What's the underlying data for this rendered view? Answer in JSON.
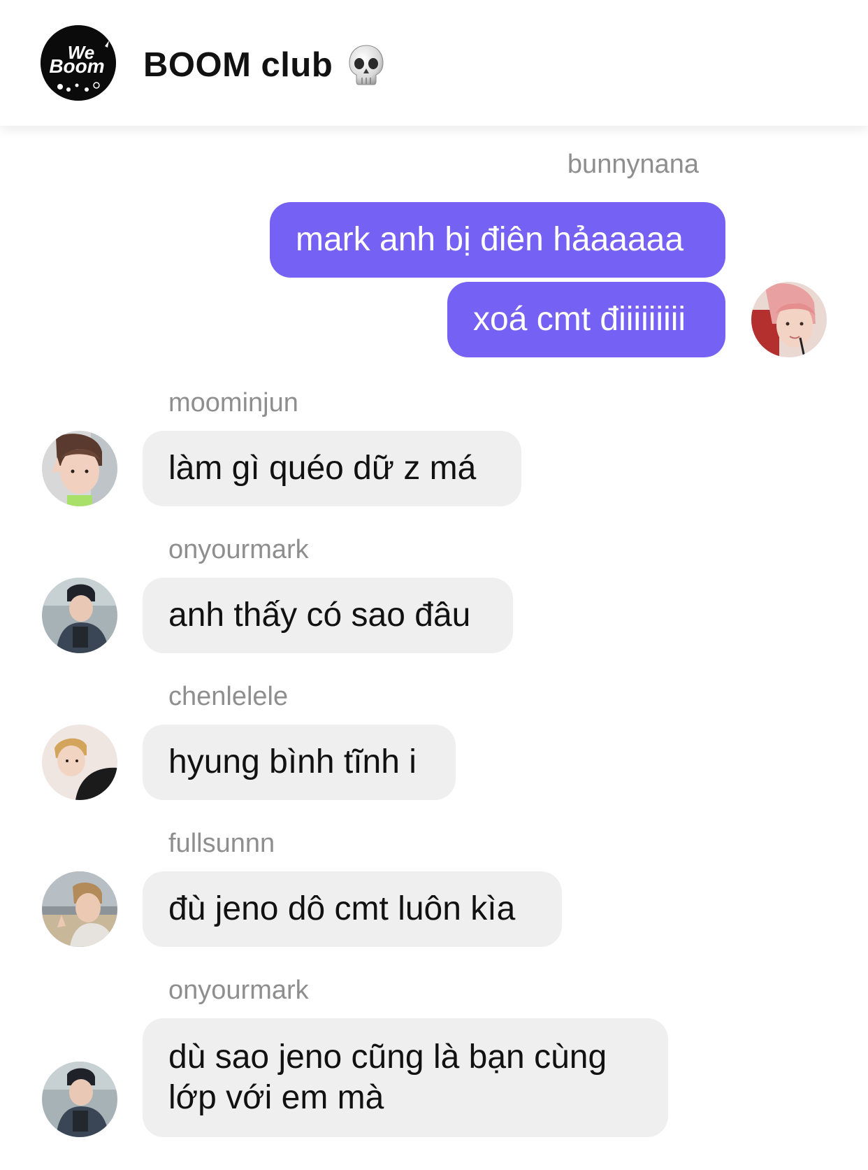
{
  "header": {
    "group_name": "BOOM club",
    "logo_text_top": "We",
    "logo_text_bottom": "Boom"
  },
  "messages": [
    {
      "sender": "bunnynana",
      "text": "mark anh bị điên hảaaaaa",
      "direction": "outgoing"
    },
    {
      "sender": "",
      "text": "xoá cmt điiiiiiiii",
      "direction": "outgoing"
    },
    {
      "sender": "moominjun",
      "text": "làm gì quéo dữ z má",
      "direction": "incoming"
    },
    {
      "sender": "onyourmark",
      "text": "anh thấy có sao đâu",
      "direction": "incoming"
    },
    {
      "sender": "chenlelele",
      "text": "hyung bình tĩnh i",
      "direction": "incoming"
    },
    {
      "sender": "fullsunnn",
      "text": "đù jeno dô cmt luôn kìa",
      "direction": "incoming"
    },
    {
      "sender": "onyourmark",
      "text": "dù sao jeno cũng là bạn cùng lớp với em mà",
      "direction": "incoming"
    }
  ],
  "colors": {
    "outgoing_bubble": "#7562f4",
    "incoming_bubble": "#efefef",
    "username": "#8e8e8e"
  },
  "icons": {
    "title_emoji": "skull-icon"
  }
}
